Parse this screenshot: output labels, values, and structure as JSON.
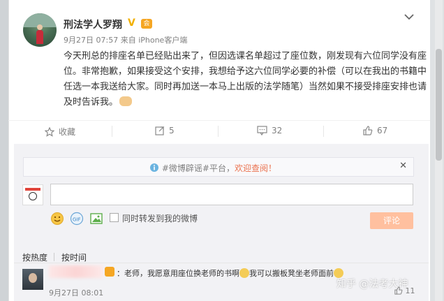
{
  "post": {
    "author": "刑法学人罗翔",
    "time": "9月27日 07:57",
    "source": "来自 iPhone客户端",
    "text": "今天刑总的排座名单已经贴出来了，但因选课名单超过了座位数，刚发现有六位同学没有座位。非常抱歉，如果接受这个安排，我想给予这六位同学必要的补偿（可以在我出的书籍中任选一本我送给大家。同时再加送一本马上出版的法学随笔）当然如果不接受排座安排也请及时告诉我。"
  },
  "actions": {
    "favorite_label": "收藏",
    "repost_count": "5",
    "comment_count": "32",
    "like_count": "67"
  },
  "rumor_notice": {
    "tag": "#微博辟谣#平台，",
    "link_text": "欢迎查阅！"
  },
  "comment_box": {
    "input_value": "",
    "repost_checkbox_label": "同时转发到我的微博",
    "submit_label": "评论"
  },
  "sort": {
    "hot_label": "按热度",
    "time_label": "按时间"
  },
  "top_comment": {
    "text_a": "：老师，我愿意用座位换老师的书啊",
    "text_b": "我可以搬板凳坐老师面前",
    "time": "9月27日 08:01",
    "like_count": "11"
  },
  "watermark": "知乎 @法考大神",
  "colors": {
    "accent_orange": "#eb7350",
    "submit_bg": "#ffc09f",
    "vip_gold": "#f5a623"
  }
}
